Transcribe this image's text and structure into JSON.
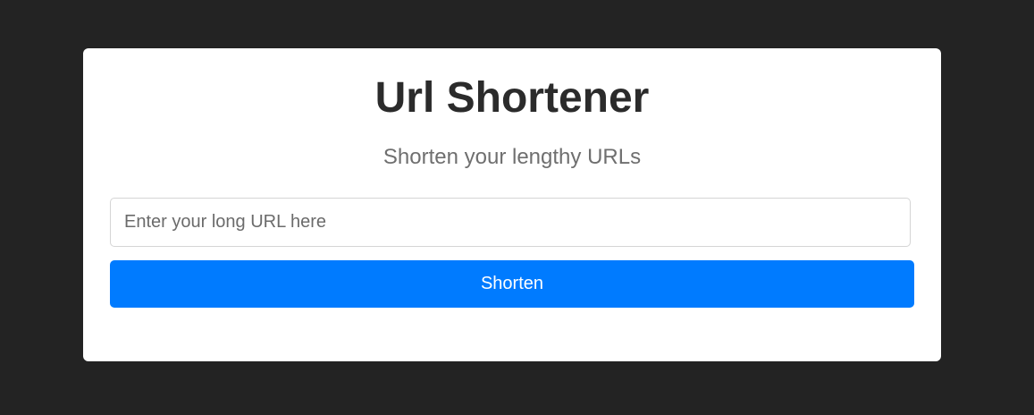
{
  "app": {
    "title": "Url Shortener",
    "subtitle": "Shorten your lengthy URLs"
  },
  "form": {
    "url_placeholder": "Enter your long URL here",
    "url_value": "",
    "submit_label": "Shorten"
  },
  "colors": {
    "page_background": "#232323",
    "card_background": "#ffffff",
    "accent": "#007bff"
  }
}
